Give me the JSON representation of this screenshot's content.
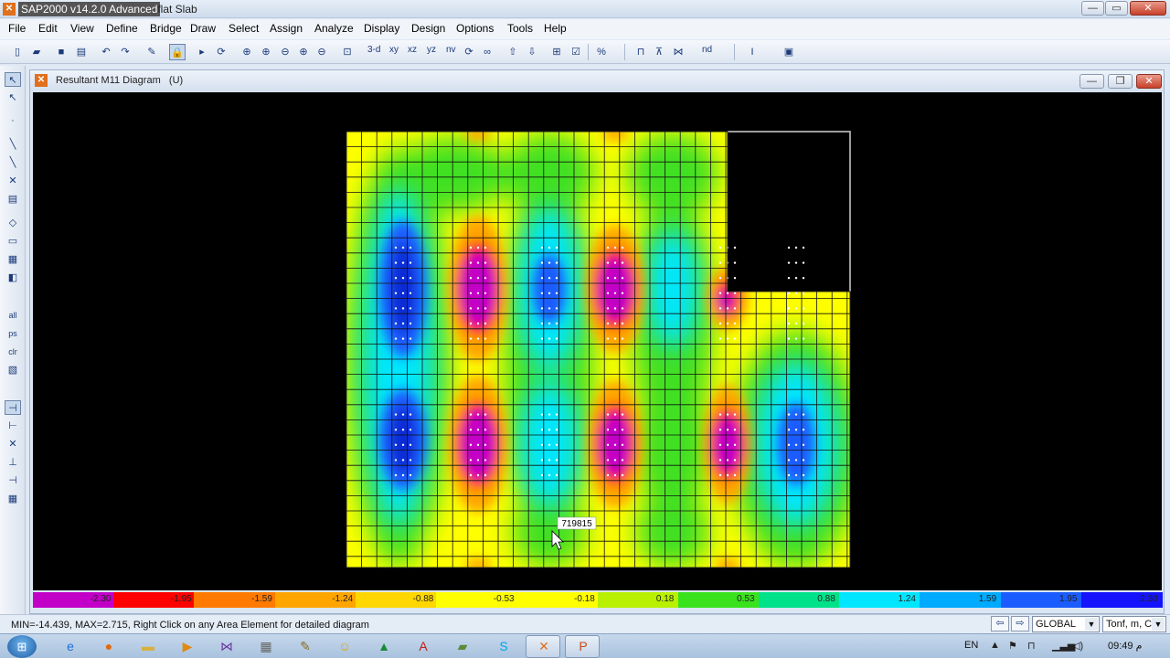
{
  "window": {
    "app_title": "SAP2000 v14.2.0 Advanced",
    "doc_title": "- flat Slab",
    "minimize_glyph": "—",
    "maximize_glyph": "▭",
    "close_glyph": "✕"
  },
  "menu": [
    "File",
    "Edit",
    "View",
    "Define",
    "Bridge",
    "Draw",
    "Select",
    "Assign",
    "Analyze",
    "Display",
    "Design",
    "Options",
    "Tools",
    "Help"
  ],
  "toolbar": {
    "view_3d": "3-d",
    "view_xy": "xy",
    "view_xz": "xz",
    "view_yz": "yz",
    "view_nv": "nv",
    "nd_label": "nd"
  },
  "inner_window": {
    "title": "Resultant M11 Diagram",
    "title_suffix": "(U)",
    "minimize_glyph": "—",
    "restore_glyph": "❐",
    "close_glyph": "✕"
  },
  "plot": {
    "tooltip_value": "719815"
  },
  "colorbar": {
    "labels": [
      "-2.30",
      "-1.95",
      "-1.59",
      "-1.24",
      "-0.88",
      "-0.53",
      "-0.18",
      "0.18",
      "0.53",
      "0.88",
      "1.24",
      "1.59",
      "1.95",
      "2.30"
    ],
    "colors": [
      "#c300c8",
      "#ff0000",
      "#ff7a00",
      "#ffa500",
      "#ffd700",
      "#ffff00",
      "#ffff00",
      "#b8f000",
      "#39e21d",
      "#00e28a",
      "#00e6ff",
      "#00aaff",
      "#1a5cff",
      "#1414ff"
    ]
  },
  "status": {
    "message": "MIN=-14.439, MAX=2.715, Right Click on any Area Element for detailed diagram",
    "coord_system": "GLOBAL",
    "units": "Tonf, m, C"
  },
  "taskbar": {
    "language": "EN",
    "clock": "09:49 م"
  }
}
